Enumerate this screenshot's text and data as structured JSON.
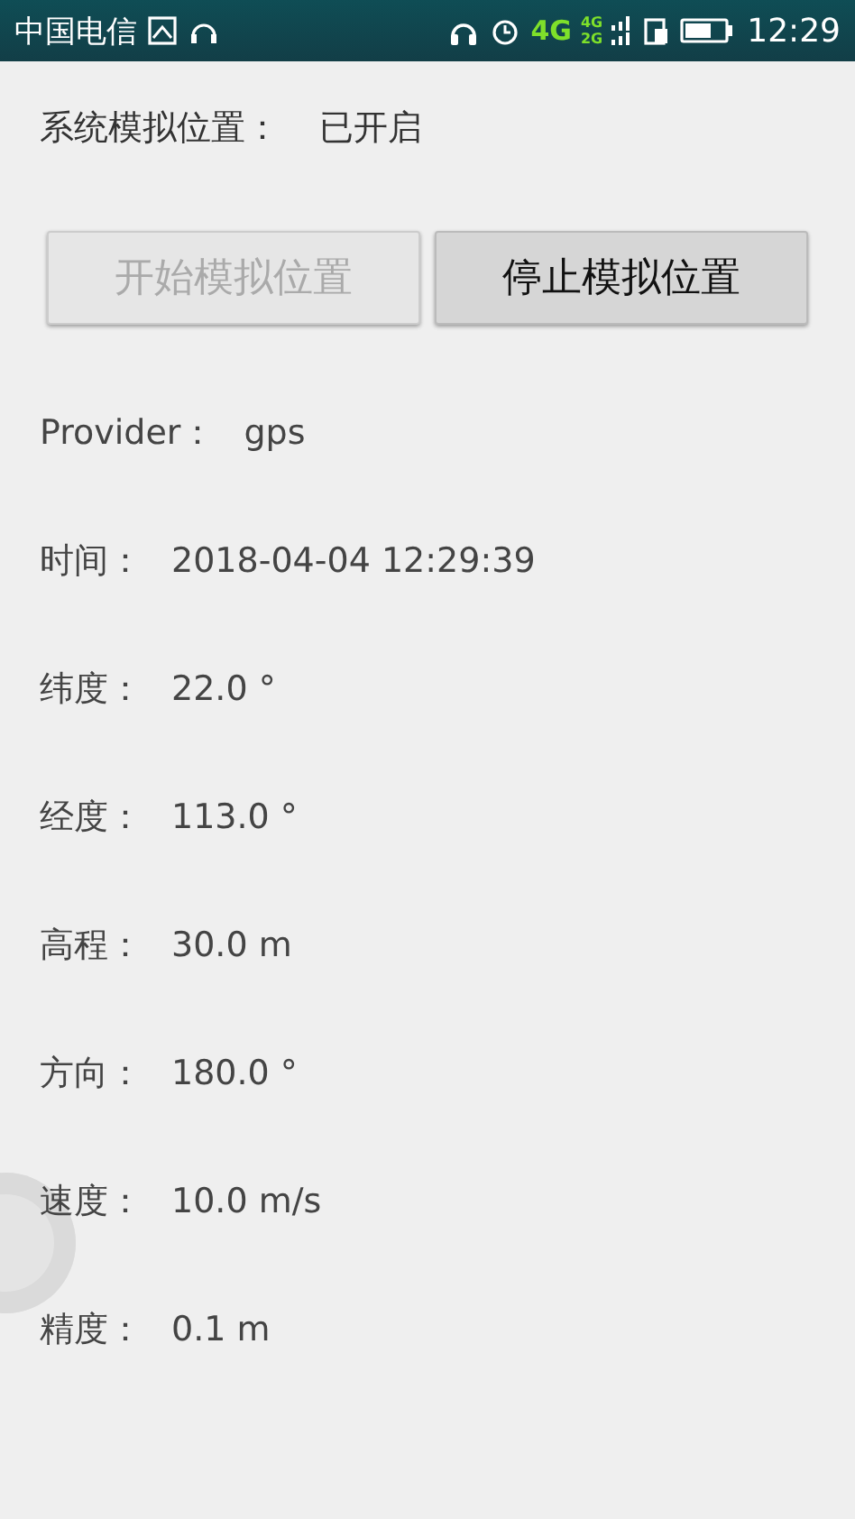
{
  "status_bar": {
    "carrier": "中国电信",
    "network": "4G",
    "sim_networks": [
      "4G",
      "2G"
    ],
    "time": "12:29"
  },
  "mock_status": {
    "label": "系统模拟位置：",
    "value": "已开启"
  },
  "buttons": [
    {
      "label": "开始模拟位置",
      "disabled": true
    },
    {
      "label": "停止模拟位置",
      "disabled": false
    }
  ],
  "fields": [
    {
      "label": "Provider：",
      "value": "gps"
    },
    {
      "label": "时间：",
      "value": "2018-04-04 12:29:39"
    },
    {
      "label": "纬度：",
      "value": "22.0 °"
    },
    {
      "label": "经度：",
      "value": "113.0 °"
    },
    {
      "label": "高程：",
      "value": "30.0 m"
    },
    {
      "label": "方向：",
      "value": "180.0 °"
    },
    {
      "label": "速度：",
      "value": "10.0 m/s"
    },
    {
      "label": "精度：",
      "value": "0.1 m"
    }
  ]
}
